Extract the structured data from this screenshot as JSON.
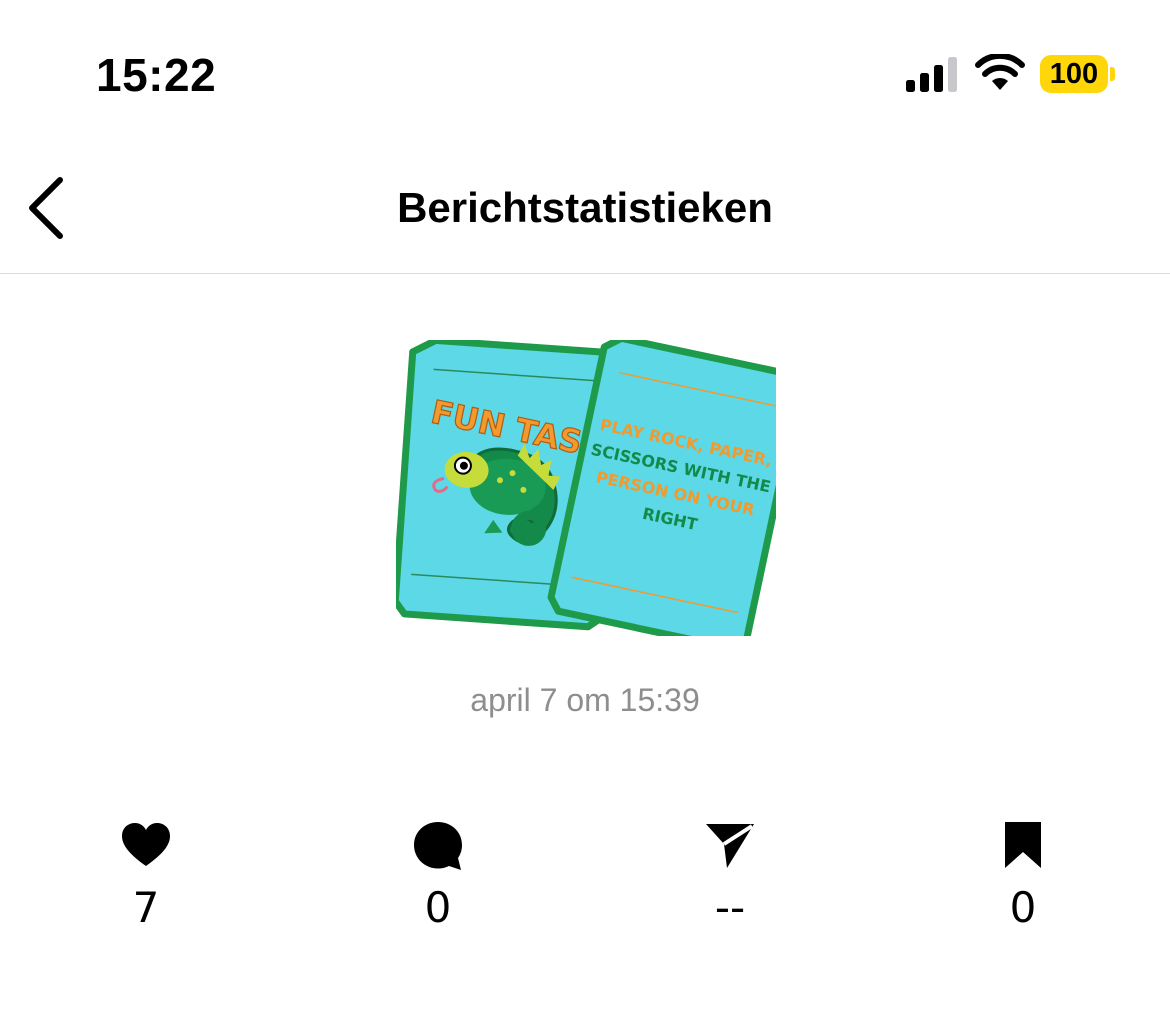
{
  "status_bar": {
    "time": "15:22",
    "battery": "100",
    "icons": [
      "signal-icon",
      "wifi-icon",
      "battery-icon"
    ],
    "battery_color": "#ffd60a"
  },
  "nav": {
    "title": "Berichtstatistieken",
    "back_icon": "chevron-left-icon"
  },
  "post": {
    "card_left_title": "FUN TASK",
    "card_right_lines": [
      "PLAY ROCK, PAPER,",
      "SCISSORS WITH THE",
      "PERSON ON YOUR",
      "RIGHT"
    ],
    "date": "april 7 om 15:39",
    "colors": {
      "card_fill": "#5cd8e6",
      "card_border": "#1f9a4a",
      "orange": "#f29a2e",
      "green": "#138a4a"
    }
  },
  "stats": [
    {
      "icon": "heart-icon",
      "value": "7"
    },
    {
      "icon": "comment-icon",
      "value": "0"
    },
    {
      "icon": "send-icon",
      "value": "--"
    },
    {
      "icon": "bookmark-icon",
      "value": "0"
    }
  ]
}
